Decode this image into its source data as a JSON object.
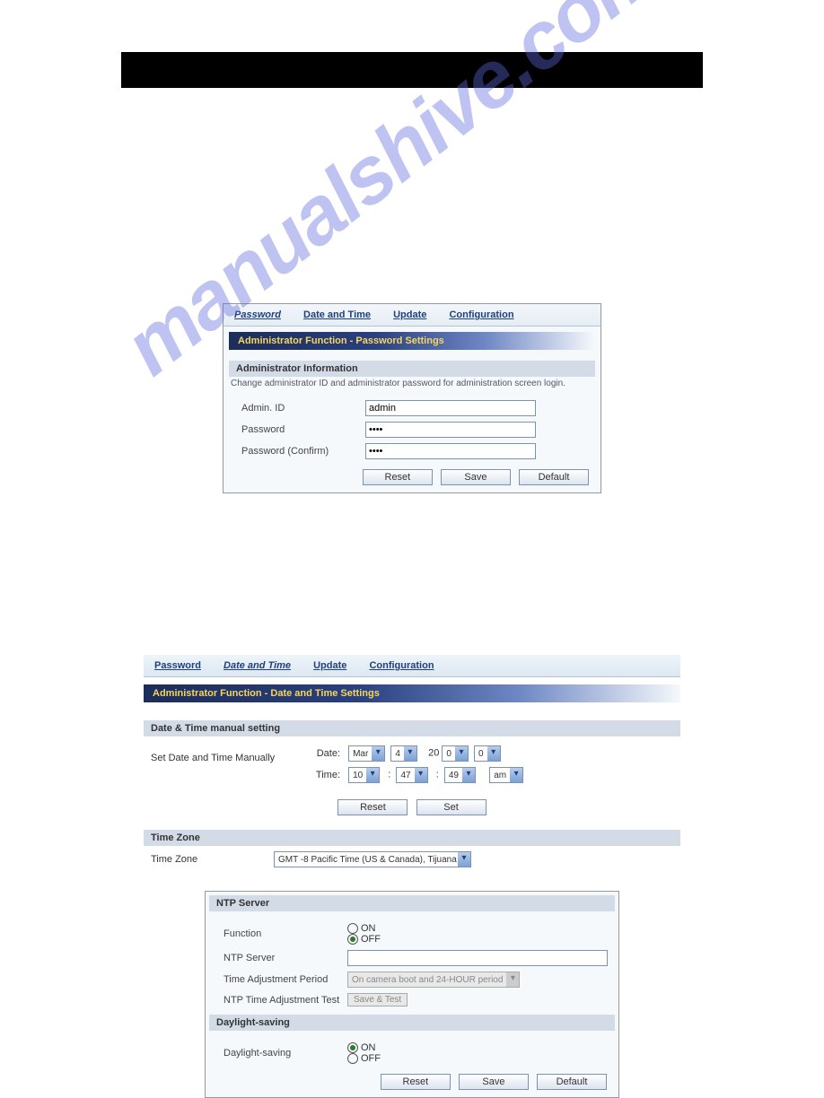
{
  "watermark": "manualshive.com",
  "tabs": {
    "password": "Password",
    "date_time": "Date and Time",
    "update": "Update",
    "configuration": "Configuration"
  },
  "panel1": {
    "subheader": "Administrator Function - Password Settings",
    "section_head": "Administrator Information",
    "desc": "Change administrator ID and administrator password for administration screen login.",
    "admin_id_label": "Admin. ID",
    "admin_id_value": "admin",
    "password_label": "Password",
    "password_confirm_label": "Password (Confirm)",
    "buttons": {
      "reset": "Reset",
      "save": "Save",
      "default": "Default"
    }
  },
  "panel2": {
    "subheader": "Administrator Function - Date and Time Settings",
    "manual_head": "Date & Time manual setting",
    "manual_desc": "Set Date and Time Manually",
    "date_label": "Date:",
    "time_label": "Time:",
    "date": {
      "month": "Mar",
      "day": "4",
      "century": "20",
      "yy1": "0",
      "yy2": "0"
    },
    "time": {
      "hh": "10",
      "mm": "47",
      "ss": "49",
      "ampm": "am"
    },
    "buttons": {
      "reset": "Reset",
      "set": "Set"
    },
    "tz_head": "Time Zone",
    "tz_label": "Time Zone",
    "tz_value": "GMT -8 Pacific Time (US & Canada), Tijuana"
  },
  "panel3": {
    "ntp_head": "NTP Server",
    "function_label": "Function",
    "on_label": "ON",
    "off_label": "OFF",
    "ntp_server_label": "NTP Server",
    "tap_label": "Time Adjustment Period",
    "tap_value": "On camera boot and 24-HOUR period",
    "ntp_test_label": "NTP Time Adjustment Test",
    "save_test_btn": "Save & Test",
    "ds_head": "Daylight-saving",
    "ds_label": "Daylight-saving",
    "buttons": {
      "reset": "Reset",
      "save": "Save",
      "default": "Default"
    }
  }
}
